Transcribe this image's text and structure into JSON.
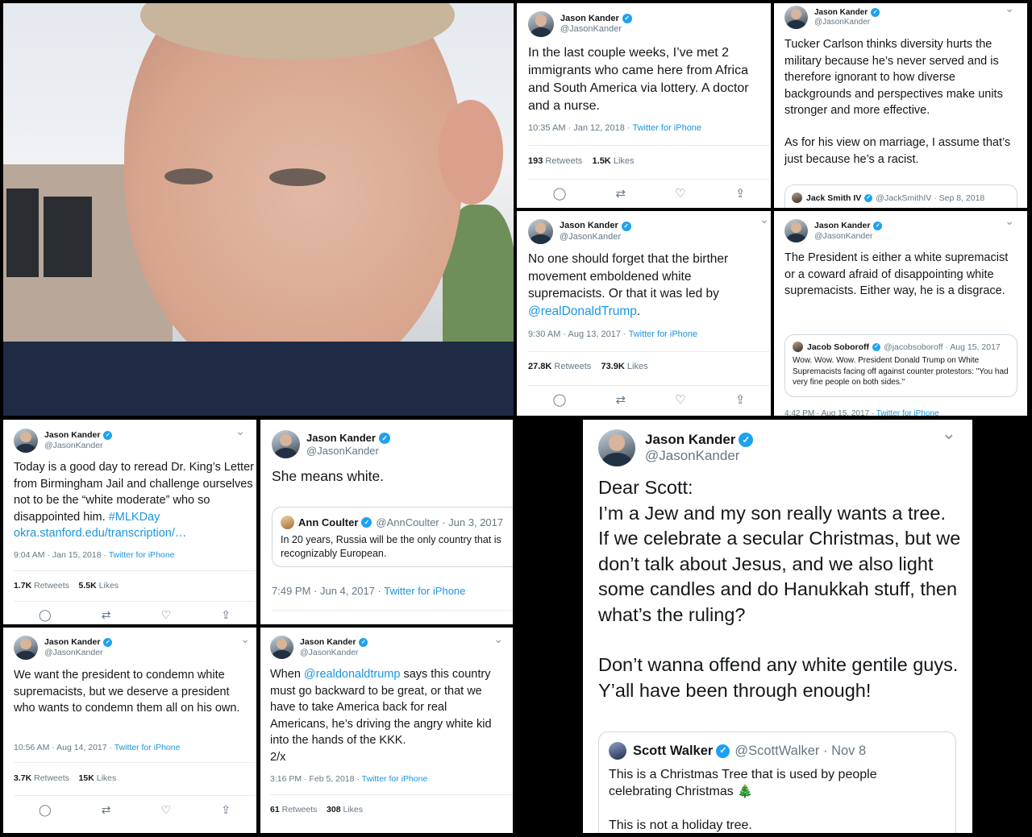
{
  "colors": {
    "twitter_blue": "#1da1f2",
    "link": "#1b95e0",
    "text": "#14171a",
    "secondary": "#657786"
  },
  "photo": {
    "description_icon": "selfie-photo"
  },
  "author": {
    "name": "Jason Kander",
    "handle": "@JasonKander"
  },
  "t1": {
    "text": "In the last couple weeks, I’ve met 2 immigrants who came here from Africa and South America via lottery. A doctor and a nurse.",
    "time": "10:35 AM · Jan 12, 2018 · ",
    "source": "Twitter for iPhone",
    "retweets": "193",
    "retweets_label": " Retweets",
    "likes": "1.5K",
    "likes_label": " Likes"
  },
  "t2": {
    "text1": "Tucker Carlson thinks diversity hurts the military because he’s never served and is therefore ignorant to how diverse backgrounds and perspectives make units stronger and more effective.",
    "text2": "As for his view on marriage, I assume that’s just because he’s a racist.",
    "quote_name": "Jack Smith IV",
    "quote_handle": "@JackSmithIV · Sep 8, 2018"
  },
  "t3": {
    "text": "No one should forget that the birther movement emboldened white supremacists. Or that it was led by ",
    "mention": "@realDonaldTrump",
    "text_end": ".",
    "time": "9:30 AM · Aug 13, 2017 · ",
    "source": "Twitter for iPhone",
    "retweets": "27.8K",
    "retweets_label": " Retweets",
    "likes": "73.9K",
    "likes_label": " Likes"
  },
  "t4": {
    "text": "The President is either a white supremacist or a coward afraid of disappointing white supremacists. Either way, he is a disgrace.",
    "quote_name": "Jacob Soboroff",
    "quote_handle": "@jacobsoboroff · Aug 15, 2017",
    "quote_text": "Wow. Wow. Wow. President Donald Trump on White Supremacists facing off against counter protestors: \"You had very fine people on both sides.\"",
    "time": "4:42 PM · Aug 15, 2017 · ",
    "source": "Twitter for iPhone"
  },
  "t5": {
    "text": "Today is a good day to reread Dr. King’s Letter from Birmingham Jail and challenge ourselves not to be the “white moderate” who so disappointed him. ",
    "hashtag": "#MLKDay",
    "url": "okra.stanford.edu/transcription/…",
    "time": "9:04 AM · Jan 15, 2018 · ",
    "source": "Twitter for iPhone",
    "retweets": "1.7K",
    "retweets_label": " Retweets",
    "likes": "5.5K",
    "likes_label": " Likes"
  },
  "t6": {
    "text": "She means white.",
    "quote_name": "Ann Coulter",
    "quote_handle": "@AnnCoulter · Jun 3, 2017",
    "quote_text": "In 20 years, Russia will be the only country that is recognizably European.",
    "time": "7:49 PM · Jun 4, 2017 · ",
    "source": "Twitter for iPhone"
  },
  "t7": {
    "text": "We want the president to condemn white supremacists, but we deserve a president who wants to condemn them all on his own.",
    "time": "10:56 AM · Aug 14, 2017 · ",
    "source": "Twitter for iPhone",
    "retweets": "3.7K",
    "retweets_label": " Retweets",
    "likes": "15K",
    "likes_label": " Likes"
  },
  "t8": {
    "text_start": "When ",
    "mention": "@realdonaldtrump",
    "text": " says this country must go backward to be great, or that we have to take America back for real Americans, he’s driving the angry white kid into the hands of the KKK.",
    "text2": "2/x",
    "time": "3:16 PM · Feb 5, 2018 · ",
    "source": "Twitter for iPhone",
    "retweets": "61",
    "retweets_label": " Retweets",
    "likes": "308",
    "likes_label": " Likes"
  },
  "t9": {
    "p1": "Dear Scott:",
    "p2": "I’m a Jew and my son really wants a tree. If we celebrate a secular Christmas, but we don’t talk about Jesus, and we also light some candles and do Hanukkah stuff, then what’s the ruling?",
    "p3": "Don’t wanna offend any white gentile guys. Y’all have been through enough!",
    "quote_name": "Scott Walker",
    "quote_handle": "@ScottWalker · Nov 8",
    "quote_text": "This is a Christmas Tree that is used by people celebrating Christmas 🎄",
    "quote_text2": "This is not a holiday tree."
  },
  "icons": {
    "verified": "✓",
    "chevron": "⌄",
    "reply": "◯",
    "retweet": "⇄",
    "like": "♡",
    "share": "⇪"
  }
}
